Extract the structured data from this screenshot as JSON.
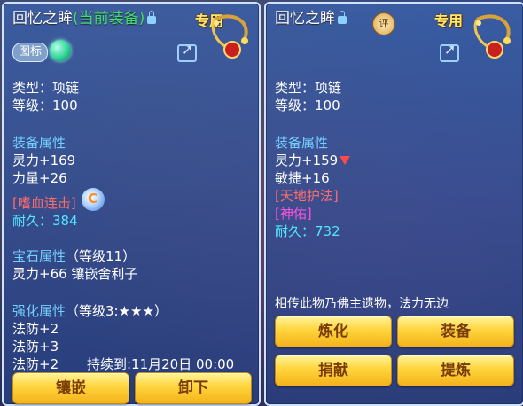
{
  "left": {
    "title": "回忆之眸",
    "equipped_tag": "(当前装备)",
    "special_badge": "专用",
    "icon_tag": "图标",
    "type_line": "类型：项链",
    "level_line": "等级：100",
    "attr_header": "装备属性",
    "attrs": [
      "灵力+169",
      "力量+26"
    ],
    "skill": "[嗜血连击]",
    "durability_label": "耐久：",
    "durability_value": "384",
    "gem_header": "宝石属性",
    "gem_level": "（等级11）",
    "gem_attr": "灵力+66 镶嵌舍利子",
    "enhance_header": "强化属性",
    "enhance_level": "（等级3:★★★）",
    "enhance_attrs": [
      "法防+2",
      "法防+3",
      "法防+2"
    ],
    "expire_text": "持续到:11月20日 00:00",
    "buttons": [
      "镶嵌",
      "卸下"
    ]
  },
  "right": {
    "title": "回忆之眸",
    "special_badge": "专用",
    "rate_badge": "评",
    "type_line": "类型：项链",
    "level_line": "等级：100",
    "attr_header": "装备属性",
    "attrs": [
      "灵力+159",
      "敏捷+16"
    ],
    "skills": [
      "[天地护法]",
      "[神佑]"
    ],
    "durability_label": "耐久：",
    "durability_value": "732",
    "description": "相传此物乃佛主遗物，法力无边",
    "buttons": [
      "炼化",
      "装备",
      "捐献",
      "提炼"
    ]
  },
  "colors": {
    "panel_border": "#cfe3ff",
    "header": "#74d0ff",
    "green": "#3fe06a",
    "cyan": "#53e6ff",
    "red": "#ff6b6b",
    "magenta": "#ff4fe0",
    "button_gold": "#ffd43c"
  }
}
